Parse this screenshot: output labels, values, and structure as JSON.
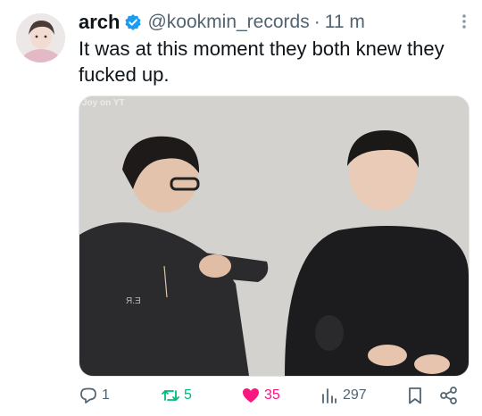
{
  "tweet": {
    "display_name": "arch",
    "handle": "@kookmin_records",
    "separator": "·",
    "time": "11 m",
    "text": "It was at this moment they both knew they fucked up.",
    "media": {
      "watermark": "Joy on YT",
      "shirt_text": "Я.Ǝ"
    }
  },
  "actions": {
    "replies": "1",
    "reposts": "5",
    "likes": "35",
    "views": "297"
  },
  "colors": {
    "verified": "#1d9bf0",
    "like": "#f91880",
    "repost": "#00ba7c",
    "muted": "#536471"
  }
}
